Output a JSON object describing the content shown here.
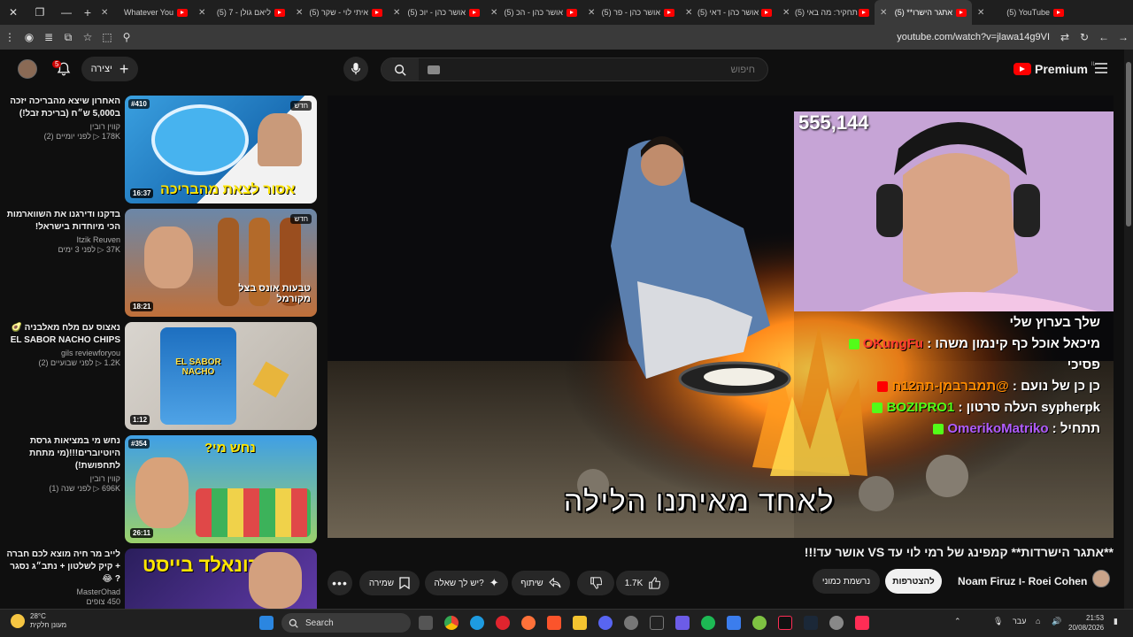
{
  "browser": {
    "tabs": [
      {
        "title": "Whatever You",
        "active": false
      },
      {
        "title": "(5) ליאם גולן - 7",
        "active": false
      },
      {
        "title": "(5) איתי לוי - שקר",
        "active": false
      },
      {
        "title": "(5) אושר כהן - יוכ",
        "active": false
      },
      {
        "title": "(5) אושר כהן - הכ",
        "active": false
      },
      {
        "title": "(5) אושר כהן - פר",
        "active": false
      },
      {
        "title": "(5) אושר כהן - דאי",
        "active": false
      },
      {
        "title": "(5) תחקיר: מה באי",
        "active": false
      },
      {
        "title": "(5) **אתגר הישרו",
        "active": true
      },
      {
        "title": "(5) YouTube",
        "active": false
      }
    ],
    "url": "youtube.com/watch?v=jlawa14g9VI"
  },
  "header": {
    "create_label": "יצירה",
    "notification_count": "5",
    "search_placeholder": "חיפוש",
    "logo_text": "Premium",
    "region": "IL"
  },
  "recommendations": [
    {
      "title": "האחרון שיצא מהבריכה יזכה ב5,000 ש״ח (בריכת זבל!)",
      "channel": "קווין רובין",
      "views": "178K",
      "age": "לפני יומיים (2)",
      "duration": "16:37",
      "badge": "#410",
      "new_label": "חדש",
      "thumb_text": "אסור לצאת מהבריכה"
    },
    {
      "title": "בדקנו ודירגנו את השווארמות הכי מיוחדות בישראל!",
      "channel": "Itzik Reuven",
      "views": "37K",
      "age": "לפני 3 ימים",
      "duration": "18:21",
      "new_label": "חדש",
      "thumb_text": "טבעות אונס בצל מקורמל"
    },
    {
      "title": "נאצוס עם מלח מאלבניה 🥑 EL SABOR NACHO CHIPS",
      "channel": "gils reviewforyou",
      "views": "1.2K",
      "age": "לפני שבועיים (2)",
      "duration": "1:12",
      "thumb_text": "EL SABOR NACHO"
    },
    {
      "title": "נחש מי במציאות גרסת היוטיוברים!!!(מי מתחת לתחפושת!)",
      "channel": "קווין רובין",
      "views": "696K",
      "age": "לפני שנה (1)",
      "duration": "26:11",
      "badge": "#354",
      "thumb_text": "נחש מי?"
    },
    {
      "title": "לייב מר חיה מוצא לכם חברה + קיק לשלטון + נתב״ג נסגר ? 😂",
      "channel": "MasterOhad",
      "views": "450",
      "age": "צופים",
      "thumb_text": "רונאלד בייסט"
    }
  ],
  "player": {
    "viewer_count": "555,144",
    "subtitle": "לאחד מאיתנו הלילה",
    "chat": [
      {
        "user": "",
        "text": "שלך בערוץ שלי",
        "color": "#ffffff"
      },
      {
        "user": "OKungFu",
        "text": "מיכאל אוכל כף קינמון משהו",
        "color": "#ff3b30"
      },
      {
        "user": "",
        "text": "פסיכי",
        "color": "#ffffff"
      },
      {
        "user": "@תמברבמן-תה12ח",
        "text": "כן כן של נועם",
        "color": "#ff8c00"
      },
      {
        "user": "BOZIPRO1",
        "text": "sypherpk העלה סרטון",
        "color": "#53fc18"
      },
      {
        "user": "OmerikoMatriko",
        "text": "תתחיל",
        "color": "#b05cff"
      }
    ]
  },
  "video": {
    "title": "**אתגר הישרדות** קמפינג של רמי לוי עד VS אושר עד!!!",
    "owner": "Noam Firuz ו- Roei Cohen",
    "subscribe_label": "להצטרפות",
    "subscribed_label": "נרשמת כמוני",
    "like_count": "1.7K",
    "share_label": "שיתוף",
    "ask_label": "יש לך שאלה?",
    "save_label": "שמירה"
  },
  "taskbar": {
    "weather_temp": "28°C",
    "weather_desc": "מעונן חלקית",
    "search_label": "Search",
    "lang": "עבר",
    "time": "21:53",
    "date": "20/08/2026"
  },
  "colors": {
    "youtube_red": "#ff0000",
    "kick_green": "#53fc18"
  }
}
